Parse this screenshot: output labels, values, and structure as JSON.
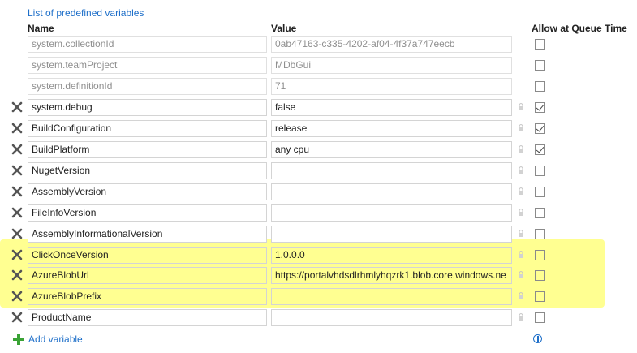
{
  "header": {
    "link_label": "List of predefined variables",
    "col_name": "Name",
    "col_value": "Value",
    "col_queue": "Allow at Queue Time"
  },
  "variables": [
    {
      "name": "system.collectionId",
      "value": "0ab47163-c335-4202-af04-4f37a747eecb",
      "readonly": true,
      "queue": false
    },
    {
      "name": "system.teamProject",
      "value": "MDbGui",
      "readonly": true,
      "queue": false
    },
    {
      "name": "system.definitionId",
      "value": "71",
      "readonly": true,
      "queue": false
    },
    {
      "name": "system.debug",
      "value": "false",
      "readonly": false,
      "queue": true
    },
    {
      "name": "BuildConfiguration",
      "value": "release",
      "readonly": false,
      "queue": true
    },
    {
      "name": "BuildPlatform",
      "value": "any cpu",
      "readonly": false,
      "queue": true
    },
    {
      "name": "NugetVersion",
      "value": "",
      "readonly": false,
      "queue": false
    },
    {
      "name": "AssemblyVersion",
      "value": "",
      "readonly": false,
      "queue": false
    },
    {
      "name": "FileInfoVersion",
      "value": "",
      "readonly": false,
      "queue": false
    },
    {
      "name": "AssemblyInformationalVersion",
      "value": "",
      "readonly": false,
      "queue": false
    },
    {
      "name": "ClickOnceVersion",
      "value": "1.0.0.0",
      "readonly": false,
      "queue": false,
      "highlighted": true
    },
    {
      "name": "AzureBlobUrl",
      "value": "https://portalvhdsdlrhmlyhqzrk1.blob.core.windows.ne",
      "readonly": false,
      "queue": false,
      "highlighted": true
    },
    {
      "name": "AzureBlobPrefix",
      "value": "",
      "readonly": false,
      "queue": false,
      "highlighted": true
    },
    {
      "name": "ProductName",
      "value": "",
      "readonly": false,
      "queue": false
    }
  ],
  "footer": {
    "add_label": "Add variable",
    "add_icon": "plus-icon",
    "info_icon": "info-icon"
  },
  "colors": {
    "link": "#1e6fc9",
    "highlight": "#ffff66",
    "add_plus": "#3aa335"
  }
}
